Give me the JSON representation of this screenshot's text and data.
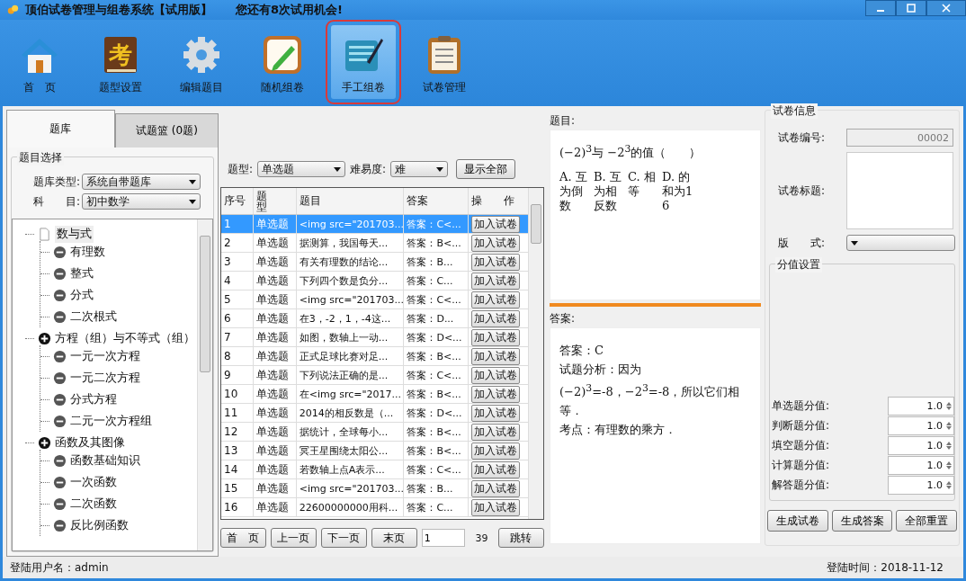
{
  "window": {
    "title": "顶伯试卷管理与组卷系统【试用版】",
    "notice": "您还有8次试用机会!"
  },
  "toolbar": [
    {
      "label": "首　页",
      "selected": false
    },
    {
      "label": "题型设置",
      "selected": false,
      "glyph": "考"
    },
    {
      "label": "编辑题目",
      "selected": false
    },
    {
      "label": "随机组卷",
      "selected": false
    },
    {
      "label": "手工组卷",
      "selected": true
    },
    {
      "label": "试卷管理",
      "selected": false
    }
  ],
  "left_tabs": [
    {
      "label": "题库",
      "selected": true
    },
    {
      "label": "试题篮 (0题)",
      "selected": false
    }
  ],
  "selection": {
    "title": "题目选择",
    "bank_label": "题库类型:",
    "bank_value": "系统自带题库",
    "subject_label": "科　　目:",
    "subject_value": "初中数学"
  },
  "tree": [
    {
      "label": "数与式",
      "kind": "page",
      "selected": true,
      "children": [
        {
          "label": "有理数",
          "selected": false
        },
        {
          "label": "整式",
          "selected": false
        },
        {
          "label": "分式",
          "selected": false
        },
        {
          "label": "二次根式",
          "selected": false
        }
      ]
    },
    {
      "label": "方程（组）与不等式（组）",
      "kind": "group",
      "selected": false,
      "children": [
        {
          "label": "一元一次方程",
          "selected": false
        },
        {
          "label": "一元二次方程",
          "selected": false
        },
        {
          "label": "分式方程",
          "selected": false
        },
        {
          "label": "二元一次方程组",
          "selected": false
        }
      ]
    },
    {
      "label": "函数及其图像",
      "kind": "group",
      "selected": false,
      "children": [
        {
          "label": "函数基础知识",
          "selected": false
        },
        {
          "label": "一次函数",
          "selected": false
        },
        {
          "label": "二次函数",
          "selected": false
        },
        {
          "label": "反比例函数",
          "selected": false
        }
      ]
    }
  ],
  "filters": {
    "type_label": "题型:",
    "type_value": "单选题",
    "level_label": "难易度:",
    "level_value": "难",
    "show_all": "显示全部"
  },
  "table": {
    "columns": [
      "序号",
      "题型",
      "题目",
      "答案",
      "操　　作"
    ],
    "rows": [
      {
        "no": "1",
        "type": "单选题",
        "title": "<img src=\"201703...",
        "answer": "答案：C<...",
        "action": "加入试卷",
        "selected": true
      },
      {
        "no": "2",
        "type": "单选题",
        "title": "据测算，我国每天...",
        "answer": "答案：B<...",
        "action": "加入试卷",
        "selected": false
      },
      {
        "no": "3",
        "type": "单选题",
        "title": "有关有理数的结论...",
        "answer": "答案：B...",
        "action": "加入试卷",
        "selected": false
      },
      {
        "no": "4",
        "type": "单选题",
        "title": "下列四个数是负分...",
        "answer": "答案：C...",
        "action": "加入试卷",
        "selected": false
      },
      {
        "no": "5",
        "type": "单选题",
        "title": "<img src=\"201703...",
        "answer": "答案：C<...",
        "action": "加入试卷",
        "selected": false
      },
      {
        "no": "6",
        "type": "单选题",
        "title": "在3，-2，1，-4这...",
        "answer": "答案：D...",
        "action": "加入试卷",
        "selected": false
      },
      {
        "no": "7",
        "type": "单选题",
        "title": "如图，数轴上一动...",
        "answer": "答案：D<...",
        "action": "加入试卷",
        "selected": false
      },
      {
        "no": "8",
        "type": "单选题",
        "title": "正式足球比赛对足...",
        "answer": "答案：B<...",
        "action": "加入试卷",
        "selected": false
      },
      {
        "no": "9",
        "type": "单选题",
        "title": "下列说法正确的是...",
        "answer": "答案：C<...",
        "action": "加入试卷",
        "selected": false
      },
      {
        "no": "10",
        "type": "单选题",
        "title": "在<img src=\"2017...",
        "answer": "答案：B<...",
        "action": "加入试卷",
        "selected": false
      },
      {
        "no": "11",
        "type": "单选题",
        "title": "2014的相反数是（...",
        "answer": "答案：D<...",
        "action": "加入试卷",
        "selected": false
      },
      {
        "no": "12",
        "type": "单选题",
        "title": "据统计，全球每小...",
        "answer": "答案：B<...",
        "action": "加入试卷",
        "selected": false
      },
      {
        "no": "13",
        "type": "单选题",
        "title": "冥王星围绕太阳公...",
        "answer": "答案：B<...",
        "action": "加入试卷",
        "selected": false
      },
      {
        "no": "14",
        "type": "单选题",
        "title": "若数轴上点A表示...",
        "answer": "答案：C<...",
        "action": "加入试卷",
        "selected": false
      },
      {
        "no": "15",
        "type": "单选题",
        "title": "<img src=\"201703...",
        "answer": "答案：B...",
        "action": "加入试卷",
        "selected": false
      },
      {
        "no": "16",
        "type": "单选题",
        "title": "22600000000用科...",
        "answer": "答案：C...",
        "action": "加入试卷",
        "selected": false
      }
    ]
  },
  "pager": {
    "buttons": [
      "首　页",
      "上一页",
      "下一页",
      "末页"
    ],
    "page": "1",
    "total": "39",
    "go": "跳转"
  },
  "question": {
    "label": "题目:",
    "stem": "(−2)$^{3}$与 −2$^{3}$的值（　　）",
    "options": [
      "A. 互为倒数",
      "B. 互为相反数",
      "C. 相等",
      "D. 的和为16"
    ]
  },
  "answer": {
    "label": "答案:",
    "lines": [
      "答案：C",
      "试题分析：因为 (−2)$^{3}$=-8，−2$^{3}$=-8，所以它们相等．",
      "考点：有理数的乘方．"
    ]
  },
  "paper": {
    "title": "试卷信息",
    "number_label": "试卷编号:",
    "number_value": "00002",
    "title_label": "试卷标题:",
    "format_label": "版　　式:",
    "score_title": "分值设置",
    "scores": [
      {
        "label": "单选题分值:",
        "value": "1.0"
      },
      {
        "label": "判断题分值:",
        "value": "1.0"
      },
      {
        "label": "填空题分值:",
        "value": "1.0"
      },
      {
        "label": "计算题分值:",
        "value": "1.0"
      },
      {
        "label": "解答题分值:",
        "value": "1.0"
      }
    ],
    "buttons": [
      "生成试卷",
      "生成答案",
      "全部重置"
    ]
  },
  "status_bar": {
    "user": "登陆用户名：admin",
    "time": "登陆时间：2018-11-12"
  }
}
